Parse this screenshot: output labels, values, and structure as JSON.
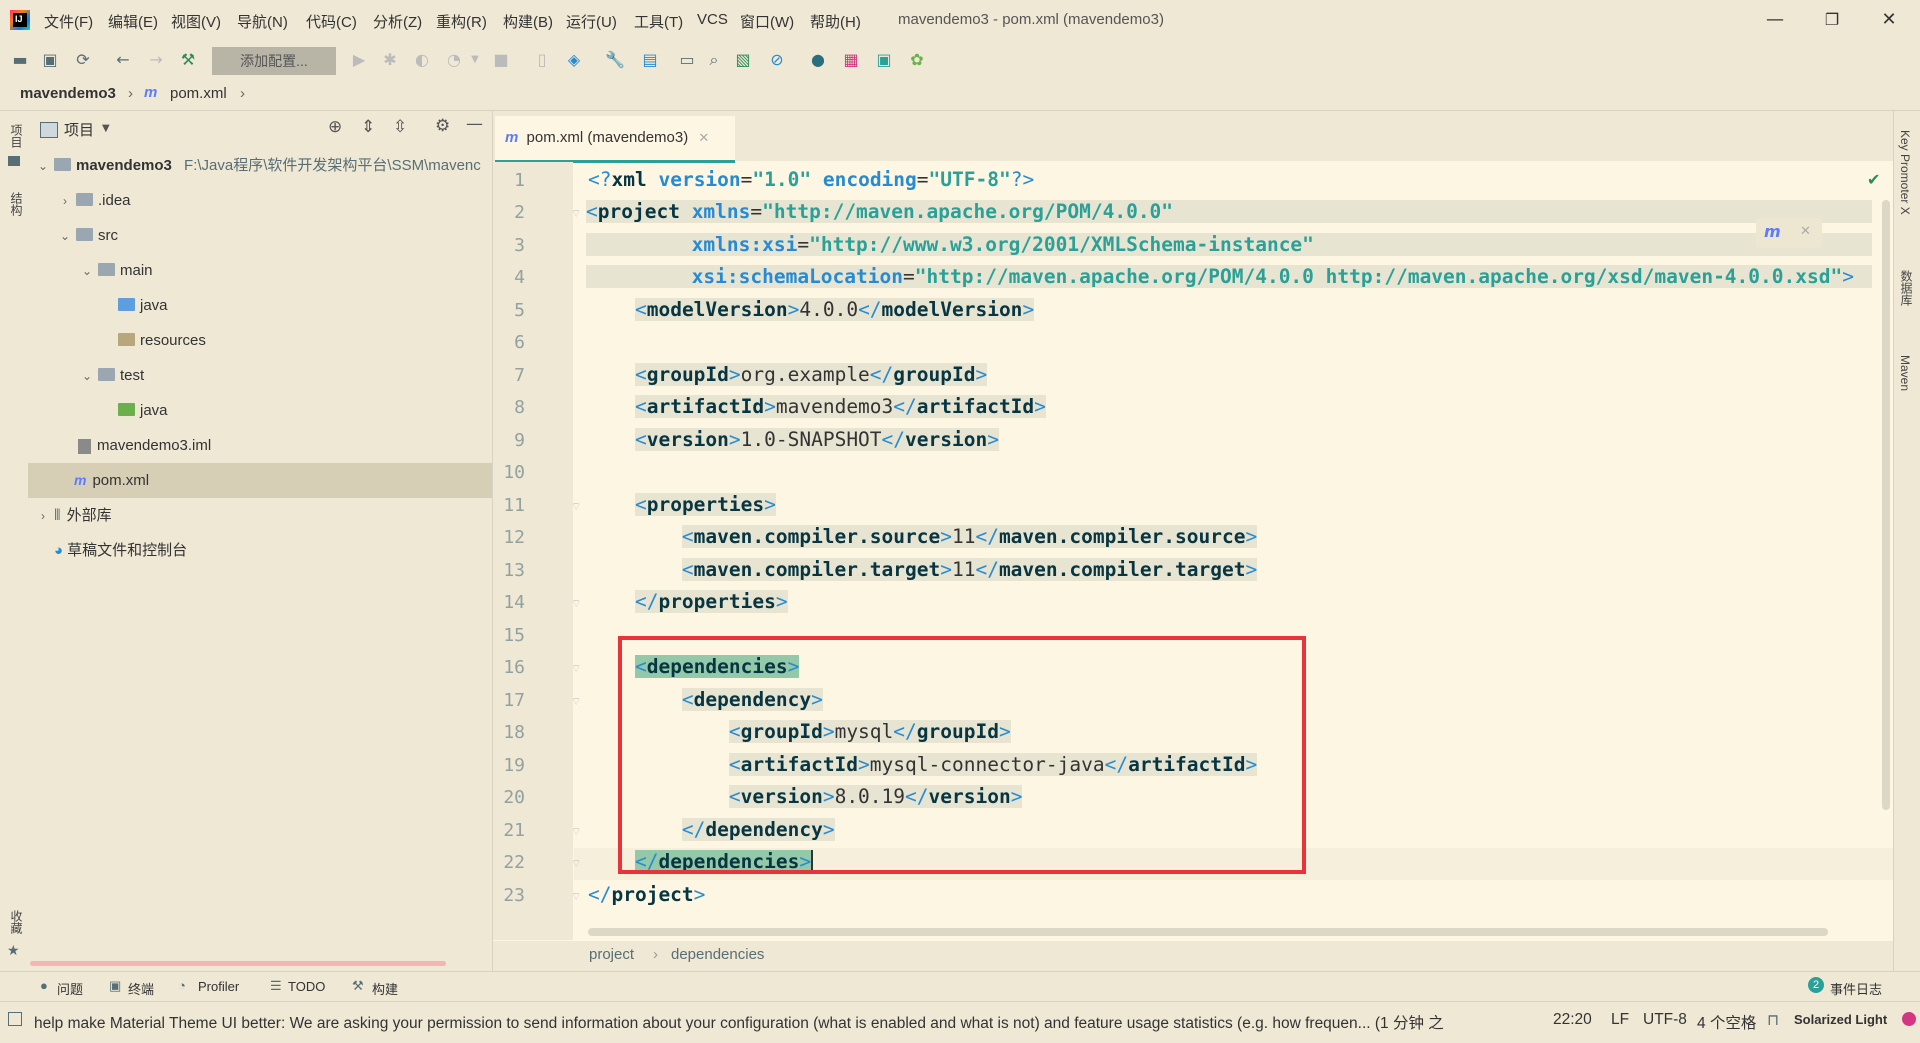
{
  "window": {
    "title": "mavendemo3 - pom.xml (mavendemo3)",
    "menu": [
      "文件(F)",
      "编辑(E)",
      "视图(V)",
      "导航(N)",
      "代码(C)",
      "分析(Z)",
      "重构(R)",
      "构建(B)",
      "运行(U)",
      "工具(T)",
      "VCS",
      "窗口(W)",
      "帮助(H)"
    ],
    "controls": {
      "minimize": "—",
      "maximize": "❐",
      "close": "✕"
    }
  },
  "toolbar": {
    "add_config_label": "添加配置..."
  },
  "navbar": {
    "project": "mavendemo3",
    "file": "pom.xml"
  },
  "left_strip": {
    "project_label": "项目",
    "structure_label": "结构",
    "favorites_label": "收藏"
  },
  "right_strip": {
    "key_promoter": "Key Promoter X",
    "database": "数据库",
    "maven": "Maven"
  },
  "project_panel": {
    "header_label": "项目",
    "tree": [
      {
        "name": "mavendemo3",
        "path": "F:\\Java程序\\软件开发架构平台\\SSM\\mavenc"
      },
      {
        "name": ".idea"
      },
      {
        "name": "src"
      },
      {
        "name": "main"
      },
      {
        "name": "java"
      },
      {
        "name": "resources"
      },
      {
        "name": "test"
      },
      {
        "name": "java"
      },
      {
        "name": "mavendemo3.iml"
      },
      {
        "name": "pom.xml"
      },
      {
        "name": "外部库"
      },
      {
        "name": "草稿文件和控制台"
      }
    ]
  },
  "editor": {
    "tab_label": "pom.xml (mavendemo3)",
    "line_numbers": [
      "1",
      "2",
      "3",
      "4",
      "5",
      "6",
      "7",
      "8",
      "9",
      "10",
      "11",
      "12",
      "13",
      "14",
      "15",
      "16",
      "17",
      "18",
      "19",
      "20",
      "21",
      "22",
      "23"
    ],
    "breadcrumb": [
      "project",
      "dependencies"
    ],
    "code": {
      "l1_ver": "\"1.0\"",
      "l1_enc": "\"UTF-8\"",
      "l2_ns": "\"http://maven.apache.org/POM/4.0.0\"",
      "l3_xsi": "\"http://www.w3.org/2001/XMLSchema-instance\"",
      "l4_schema": "\"http://maven.apache.org/POM/4.0.0 http://maven.apache.org/xsd/maven-4.0.0.xsd\"",
      "model_version": "4.0.0",
      "group_id": "org.example",
      "artifact_id": "mavendemo3",
      "version": "1.0-SNAPSHOT",
      "source": "11",
      "target": "11",
      "dep_group": "mysql",
      "dep_artifact": "mysql-connector-java",
      "dep_version": "8.0.19"
    }
  },
  "bottom_tools": [
    "问题",
    "终端",
    "Profiler",
    "TODO",
    "构建"
  ],
  "event_log": {
    "count": "2",
    "label": "事件日志"
  },
  "status": {
    "message": "help make Material Theme UI better: We are asking your permission to send information about your configuration (what is enabled and what is not) and feature usage statistics (e.g. how frequen... (1 分钟 之",
    "position": "22:20",
    "line_sep": "LF",
    "encoding": "UTF-8",
    "indent": "4 个空格",
    "theme": "Solarized Light"
  }
}
